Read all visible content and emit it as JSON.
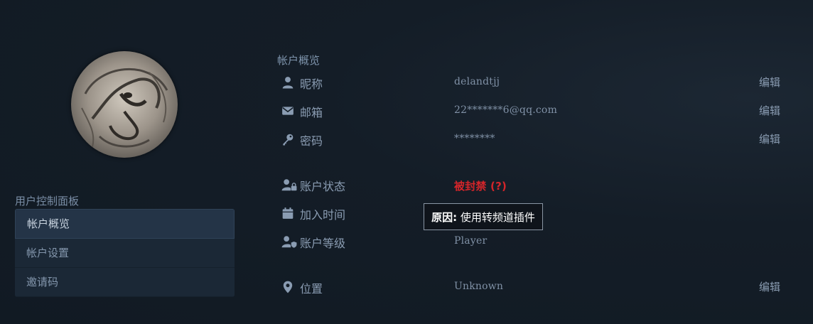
{
  "sidebar": {
    "title": "用户控制面板",
    "items": [
      {
        "label": "帐户概览",
        "active": true
      },
      {
        "label": "帐户设置",
        "active": false
      },
      {
        "label": "邀请码",
        "active": false
      }
    ]
  },
  "overview": {
    "title": "帐户概览",
    "edit_label": "编辑",
    "nickname": {
      "label": "昵称",
      "value": "delandtjj",
      "icon": "user-icon"
    },
    "email": {
      "label": "邮箱",
      "value": "22*******6@qq.com",
      "icon": "envelope-icon"
    },
    "password": {
      "label": "密码",
      "value": "********",
      "icon": "key-icon"
    },
    "status": {
      "label": "账户状态",
      "value": "被封禁 (?)",
      "icon": "user-lock-icon",
      "color": "#d4252a"
    },
    "join_time": {
      "label": "加入时间",
      "value": "",
      "icon": "calendar-icon"
    },
    "level": {
      "label": "账户等级",
      "value": "Player",
      "icon": "user-shield-icon"
    },
    "location": {
      "label": "位置",
      "value": "Unknown",
      "icon": "map-marker-icon"
    }
  },
  "tooltip": {
    "key": "原因:",
    "text": " 使用转频道插件"
  }
}
